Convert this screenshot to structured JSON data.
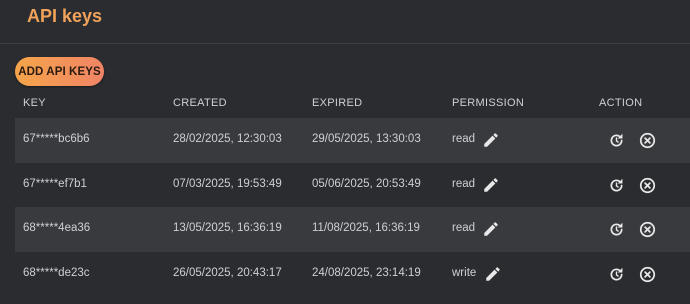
{
  "page": {
    "title": "API keys"
  },
  "toolbar": {
    "add_label": "ADD API KEYS"
  },
  "table": {
    "columns": [
      "KEY",
      "CREATED",
      "EXPIRED",
      "PERMISSION",
      "ACTION"
    ],
    "rows": [
      {
        "key": "67*****bc6b6",
        "created": "28/02/2025, 12:30:03",
        "expired": "29/05/2025, 13:30:03",
        "permission": "read"
      },
      {
        "key": "67*****ef7b1",
        "created": "07/03/2025, 19:53:49",
        "expired": "05/06/2025, 20:53:49",
        "permission": "read"
      },
      {
        "key": "68*****4ea36",
        "created": "13/05/2025, 16:36:19",
        "expired": "11/08/2025, 16:36:19",
        "permission": "read"
      },
      {
        "key": "68*****de23c",
        "created": "26/05/2025, 20:43:17",
        "expired": "24/08/2025, 23:14:19",
        "permission": "write"
      }
    ]
  },
  "icons": {
    "edit": "pencil-icon",
    "renew": "renew-icon",
    "revoke": "close-circle-icon"
  },
  "colors": {
    "accent": "#f0a25a",
    "background": "#2b2c30",
    "row_shaded": "#393a3e",
    "button_gradient_start": "#f5a54a",
    "button_gradient_end": "#f08466"
  }
}
